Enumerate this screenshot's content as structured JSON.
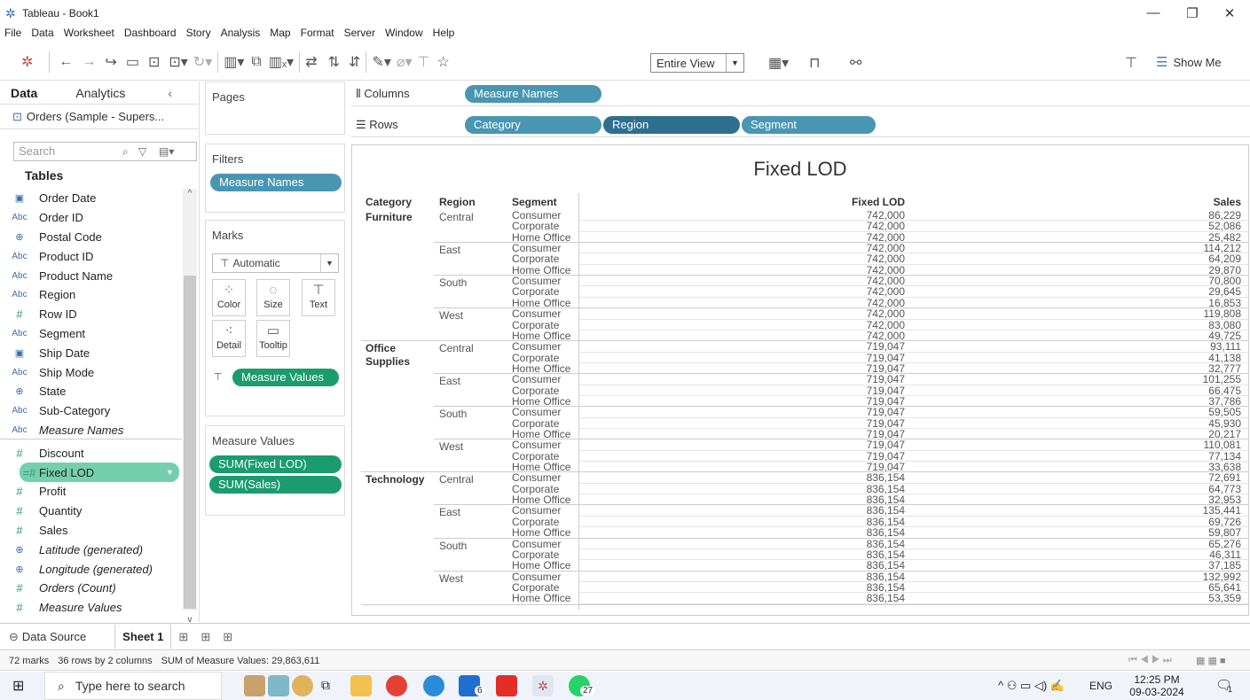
{
  "window": {
    "title": "Tableau - Book1",
    "min": "—",
    "max": "❐",
    "close": "✕"
  },
  "menu": [
    "File",
    "Data",
    "Worksheet",
    "Dashboard",
    "Story",
    "Analysis",
    "Map",
    "Format",
    "Server",
    "Window",
    "Help"
  ],
  "toolbar": {
    "fit_value": "Entire View",
    "show_me": "Show Me"
  },
  "data_pane": {
    "tab_data": "Data",
    "tab_analytics": "Analytics",
    "datasource": "Orders (Sample - Supers...",
    "search_placeholder": "Search",
    "tables_header": "Tables",
    "fields": [
      {
        "name": "Order Date",
        "type": "date",
        "italic": false
      },
      {
        "name": "Order ID",
        "type": "abc",
        "italic": false
      },
      {
        "name": "Postal Code",
        "type": "geo",
        "italic": false
      },
      {
        "name": "Product ID",
        "type": "abc",
        "italic": false
      },
      {
        "name": "Product Name",
        "type": "abc",
        "italic": false
      },
      {
        "name": "Region",
        "type": "abc",
        "italic": false
      },
      {
        "name": "Row ID",
        "type": "num",
        "italic": false
      },
      {
        "name": "Segment",
        "type": "abc",
        "italic": false
      },
      {
        "name": "Ship Date",
        "type": "date",
        "italic": false
      },
      {
        "name": "Ship Mode",
        "type": "abc",
        "italic": false
      },
      {
        "name": "State",
        "type": "geo",
        "italic": false
      },
      {
        "name": "Sub-Category",
        "type": "abc",
        "italic": false
      },
      {
        "name": "Measure Names",
        "type": "abc",
        "italic": true
      },
      {
        "name": "Discount",
        "type": "num",
        "italic": false
      },
      {
        "name": "Fixed LOD",
        "type": "num",
        "italic": false,
        "selected": true
      },
      {
        "name": "Profit",
        "type": "num",
        "italic": false
      },
      {
        "name": "Quantity",
        "type": "num",
        "italic": false
      },
      {
        "name": "Sales",
        "type": "num",
        "italic": false
      },
      {
        "name": "Latitude (generated)",
        "type": "geo",
        "italic": true
      },
      {
        "name": "Longitude (generated)",
        "type": "geo",
        "italic": true
      },
      {
        "name": "Orders (Count)",
        "type": "num",
        "italic": true
      },
      {
        "name": "Measure Values",
        "type": "num",
        "italic": true
      }
    ]
  },
  "cards": {
    "pages": "Pages",
    "filters": "Filters",
    "filter_pill": "Measure Names",
    "marks": "Marks",
    "mark_type": "Automatic",
    "mark_buttons": [
      "Color",
      "Size",
      "Text",
      "Detail",
      "Tooltip"
    ],
    "marks_pill": "Measure Values",
    "measure_values": "Measure Values",
    "mv_pills": [
      "SUM(Fixed LOD)",
      "SUM(Sales)"
    ]
  },
  "shelves": {
    "columns_label": "Columns",
    "rows_label": "Rows",
    "columns_pills": [
      "Measure Names"
    ],
    "rows_pills": [
      "Category",
      "Region",
      "Segment"
    ]
  },
  "viz": {
    "title": "Fixed LOD",
    "headers": {
      "category": "Category",
      "region": "Region",
      "segment": "Segment",
      "fixed_lod": "Fixed LOD",
      "sales": "Sales"
    },
    "table": [
      {
        "category": "Furniture",
        "regions": [
          {
            "region": "Central",
            "rows": [
              [
                "Consumer",
                "742,000",
                "86,229"
              ],
              [
                "Corporate",
                "742,000",
                "52,086"
              ],
              [
                "Home Office",
                "742,000",
                "25,482"
              ]
            ]
          },
          {
            "region": "East",
            "rows": [
              [
                "Consumer",
                "742,000",
                "114,212"
              ],
              [
                "Corporate",
                "742,000",
                "64,209"
              ],
              [
                "Home Office",
                "742,000",
                "29,870"
              ]
            ]
          },
          {
            "region": "South",
            "rows": [
              [
                "Consumer",
                "742,000",
                "70,800"
              ],
              [
                "Corporate",
                "742,000",
                "29,645"
              ],
              [
                "Home Office",
                "742,000",
                "16,853"
              ]
            ]
          },
          {
            "region": "West",
            "rows": [
              [
                "Consumer",
                "742,000",
                "119,808"
              ],
              [
                "Corporate",
                "742,000",
                "83,080"
              ],
              [
                "Home Office",
                "742,000",
                "49,725"
              ]
            ]
          }
        ]
      },
      {
        "category": "Office Supplies",
        "regions": [
          {
            "region": "Central",
            "rows": [
              [
                "Consumer",
                "719,047",
                "93,111"
              ],
              [
                "Corporate",
                "719,047",
                "41,138"
              ],
              [
                "Home Office",
                "719,047",
                "32,777"
              ]
            ]
          },
          {
            "region": "East",
            "rows": [
              [
                "Consumer",
                "719,047",
                "101,255"
              ],
              [
                "Corporate",
                "719,047",
                "66,475"
              ],
              [
                "Home Office",
                "719,047",
                "37,786"
              ]
            ]
          },
          {
            "region": "South",
            "rows": [
              [
                "Consumer",
                "719,047",
                "59,505"
              ],
              [
                "Corporate",
                "719,047",
                "45,930"
              ],
              [
                "Home Office",
                "719,047",
                "20,217"
              ]
            ]
          },
          {
            "region": "West",
            "rows": [
              [
                "Consumer",
                "719,047",
                "110,081"
              ],
              [
                "Corporate",
                "719,047",
                "77,134"
              ],
              [
                "Home Office",
                "719,047",
                "33,638"
              ]
            ]
          }
        ]
      },
      {
        "category": "Technology",
        "regions": [
          {
            "region": "Central",
            "rows": [
              [
                "Consumer",
                "836,154",
                "72,691"
              ],
              [
                "Corporate",
                "836,154",
                "64,773"
              ],
              [
                "Home Office",
                "836,154",
                "32,953"
              ]
            ]
          },
          {
            "region": "East",
            "rows": [
              [
                "Consumer",
                "836,154",
                "135,441"
              ],
              [
                "Corporate",
                "836,154",
                "69,726"
              ],
              [
                "Home Office",
                "836,154",
                "59,807"
              ]
            ]
          },
          {
            "region": "South",
            "rows": [
              [
                "Consumer",
                "836,154",
                "65,276"
              ],
              [
                "Corporate",
                "836,154",
                "46,311"
              ],
              [
                "Home Office",
                "836,154",
                "37,185"
              ]
            ]
          },
          {
            "region": "West",
            "rows": [
              [
                "Consumer",
                "836,154",
                "132,992"
              ],
              [
                "Corporate",
                "836,154",
                "65,641"
              ],
              [
                "Home Office",
                "836,154",
                "53,359"
              ]
            ]
          }
        ]
      }
    ]
  },
  "sheets": {
    "data_source": "Data Source",
    "sheet1": "Sheet 1"
  },
  "status": {
    "marks": "72 marks",
    "rows_cols": "36 rows by 2 columns",
    "sum": "SUM of Measure Values: 29,863,611"
  },
  "taskbar": {
    "search_placeholder": "Type here to search",
    "lang": "ENG",
    "time": "12:25 PM",
    "date": "09-03-2024",
    "badge_mail": "6",
    "badge_whatsapp": "27",
    "notif": "1"
  }
}
